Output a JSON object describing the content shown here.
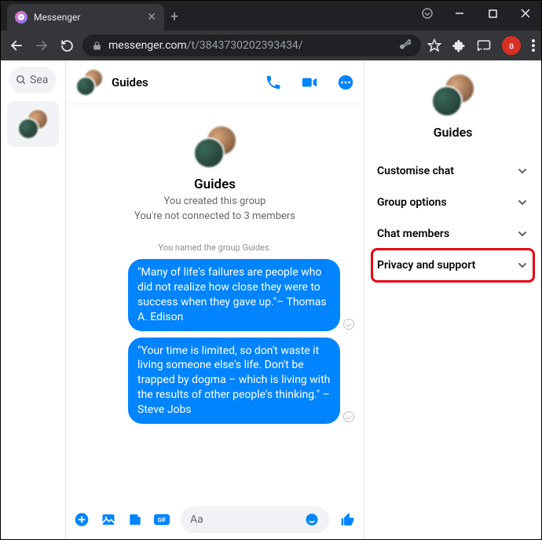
{
  "browser": {
    "tab_title": "Messenger",
    "url_host": "messenger.com",
    "url_path": "/t/3843730202393434/",
    "profile_letter": "a"
  },
  "sidebar": {
    "search_placeholder": "Sea"
  },
  "chat": {
    "title": "Guides",
    "intro_title": "Guides",
    "intro_line1": "You created this group",
    "intro_line2": "You're not connected to 3 members",
    "system_line": "You named the group Guides.",
    "messages": [
      {
        "text": "\"Many of life's failures are people who did not realize how close they were to success when they gave up.\"– Thomas A. Edison"
      },
      {
        "text": "\"Your time is limited, so don't waste it living someone else's life. Don't be trapped by dogma – which is living with the results of other people's thinking.\" – Steve Jobs"
      }
    ],
    "compose_placeholder": "Aa"
  },
  "details": {
    "title": "Guides",
    "options": [
      {
        "label": "Customise chat"
      },
      {
        "label": "Group options"
      },
      {
        "label": "Chat members"
      },
      {
        "label": "Privacy and support"
      }
    ]
  }
}
